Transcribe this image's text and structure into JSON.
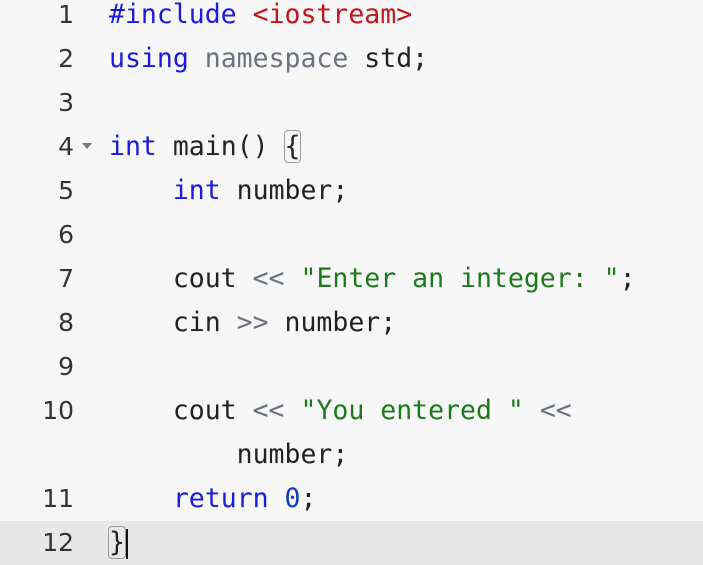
{
  "editor": {
    "language": "cpp",
    "active_line": 12,
    "lines": [
      {
        "n": "1",
        "tokens": [
          {
            "t": "#include",
            "c": "inc"
          },
          {
            "t": " "
          },
          {
            "t": "<iostream>",
            "c": "hdr"
          }
        ]
      },
      {
        "n": "2",
        "tokens": [
          {
            "t": "using",
            "c": "kw"
          },
          {
            "t": " "
          },
          {
            "t": "namespace",
            "c": "ns"
          },
          {
            "t": " std;"
          }
        ]
      },
      {
        "n": "3",
        "tokens": []
      },
      {
        "n": "4",
        "fold": true,
        "tokens": [
          {
            "t": "int",
            "c": "kw"
          },
          {
            "t": " main() "
          },
          {
            "t": "{",
            "c": "brace"
          }
        ]
      },
      {
        "n": "5",
        "tokens": [
          {
            "t": "    "
          },
          {
            "t": "int",
            "c": "kw"
          },
          {
            "t": " number;"
          }
        ]
      },
      {
        "n": "6",
        "tokens": []
      },
      {
        "n": "7",
        "tokens": [
          {
            "t": "    cout "
          },
          {
            "t": "<<",
            "c": "op"
          },
          {
            "t": " "
          },
          {
            "t": "\"Enter an integer: \"",
            "c": "str"
          },
          {
            "t": ";"
          }
        ]
      },
      {
        "n": "8",
        "tokens": [
          {
            "t": "    cin "
          },
          {
            "t": ">>",
            "c": "op"
          },
          {
            "t": " number;"
          }
        ]
      },
      {
        "n": "9",
        "tokens": []
      },
      {
        "n": "10",
        "tokens": [
          {
            "t": "    cout "
          },
          {
            "t": "<<",
            "c": "op"
          },
          {
            "t": " "
          },
          {
            "t": "\"You entered \"",
            "c": "str"
          },
          {
            "t": " "
          },
          {
            "t": "<<",
            "c": "op"
          }
        ]
      },
      {
        "n": "",
        "tokens": [
          {
            "t": "        number;"
          }
        ]
      },
      {
        "n": "11",
        "tokens": [
          {
            "t": "    "
          },
          {
            "t": "return",
            "c": "kw"
          },
          {
            "t": " "
          },
          {
            "t": "0",
            "c": "num"
          },
          {
            "t": ";"
          }
        ]
      },
      {
        "n": "12",
        "active": true,
        "tokens": [
          {
            "t": "}",
            "c": "brace"
          },
          {
            "t": "",
            "c": "cursor"
          }
        ]
      }
    ]
  }
}
